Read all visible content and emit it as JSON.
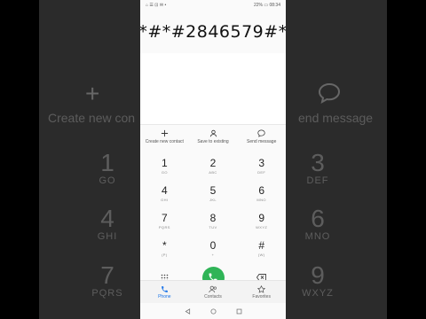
{
  "status": {
    "left": "⌂ ☰ ⊡ ✉ •",
    "right": "22% ▭ 08:34"
  },
  "dialer": {
    "number": "*#*#2846579#*"
  },
  "actions": [
    {
      "label": "Create new contact",
      "icon": "plus-icon"
    },
    {
      "label": "Save to existing",
      "icon": "person-icon"
    },
    {
      "label": "Send message",
      "icon": "message-icon"
    }
  ],
  "keys": [
    [
      {
        "digit": "1",
        "letters": "GO"
      },
      {
        "digit": "2",
        "letters": "ABC"
      },
      {
        "digit": "3",
        "letters": "DEF"
      }
    ],
    [
      {
        "digit": "4",
        "letters": "GHI"
      },
      {
        "digit": "5",
        "letters": "JKL"
      },
      {
        "digit": "6",
        "letters": "MNO"
      }
    ],
    [
      {
        "digit": "7",
        "letters": "PQRS"
      },
      {
        "digit": "8",
        "letters": "TUV"
      },
      {
        "digit": "9",
        "letters": "WXYZ"
      }
    ],
    [
      {
        "digit": "*",
        "letters": "(P)"
      },
      {
        "digit": "0",
        "letters": "+"
      },
      {
        "digit": "#",
        "letters": "(W)"
      }
    ]
  ],
  "tabs": [
    {
      "label": "Phone",
      "icon": "phone-icon",
      "active": true
    },
    {
      "label": "Contacts",
      "icon": "contacts-icon",
      "active": false
    },
    {
      "label": "Favorites",
      "icon": "star-icon",
      "active": false
    }
  ],
  "background": {
    "left_text": "Create new con",
    "right_text": "end message",
    "left_keys": [
      {
        "digit": "1",
        "letters": "GO"
      },
      {
        "digit": "4",
        "letters": "GHI"
      },
      {
        "digit": "7",
        "letters": "PQRS"
      }
    ],
    "right_keys": [
      {
        "digit": "3",
        "letters": "DEF"
      },
      {
        "digit": "6",
        "letters": "MNO"
      },
      {
        "digit": "9",
        "letters": "WXYZ"
      }
    ]
  },
  "colors": {
    "call": "#2fb457",
    "accent": "#1a73e8"
  }
}
